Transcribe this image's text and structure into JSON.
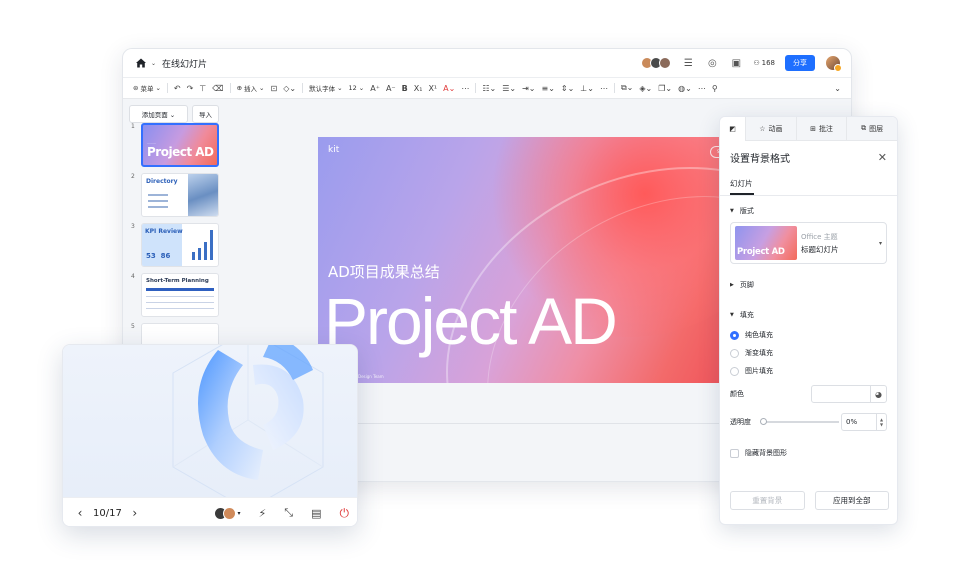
{
  "app": {
    "doc_title": "在线幻灯片",
    "share_label": "分享",
    "online_count": "168"
  },
  "toolbar": {
    "menu_label": "菜单",
    "insert_label": "插入",
    "font_label": "默认字体",
    "font_size": "12"
  },
  "slides_panel": {
    "add_page_label": "添加页面",
    "import_label": "导入",
    "thumbnails": [
      {
        "num": "1",
        "title": "Project AD"
      },
      {
        "num": "2",
        "title": "Directory"
      },
      {
        "num": "3",
        "title": "KPI Review",
        "n1": "53",
        "n2": "86"
      },
      {
        "num": "4",
        "title": "Short-Term Planning"
      },
      {
        "num": "5",
        "title": ""
      }
    ]
  },
  "slide": {
    "brand": "kit",
    "subtitle": "AD项目成果总结",
    "title": "Project AD",
    "footer": "Design Team"
  },
  "presenter": {
    "page": "10/17"
  },
  "side_panel": {
    "tabs": [
      "动画",
      "批注",
      "图层"
    ],
    "title": "设置背景格式",
    "subtab": "幻灯片",
    "section_layout": "版式",
    "layout_theme": "Office 主题",
    "layout_name": "标题幻灯片",
    "layout_thumb_title": "Project AD",
    "section_footer": "页脚",
    "section_fill": "填充",
    "fill_options": [
      "纯色填充",
      "渐变填充",
      "图片填充"
    ],
    "fill_selected": 0,
    "color_label": "颜色",
    "opacity_label": "透明度",
    "opacity_value": "0%",
    "hide_bg_label": "隐藏背景图形",
    "reset_label": "重置背景",
    "apply_all_label": "应用到全部"
  },
  "colors": {
    "accent": "#3370ff",
    "share_button": "#1e6fff",
    "power": "#e03a3a"
  }
}
